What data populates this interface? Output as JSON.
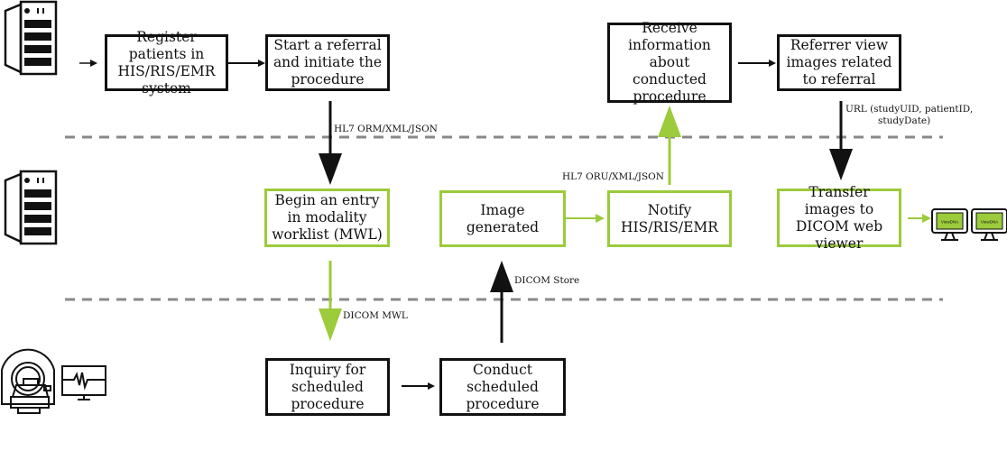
{
  "colors": {
    "primary": "#111111",
    "accent": "#9ccb3b",
    "divider": "#888888"
  },
  "icons": {
    "top": "server-icon",
    "middle": "server-icon",
    "bottom": "ct-scanner-icon",
    "bottom_monitor": "waveform-monitor-icon",
    "viewer": "viewer-monitor-icon"
  },
  "boxes": {
    "register": "Register patients in HIS/RIS/EMR system",
    "referral": "Start a referral and initiate the procedure",
    "receive": "Receive information about conducted procedure",
    "referrer_view": "Referrer view images related to referral",
    "mwl_entry": "Begin an entry in modality worklist (MWL)",
    "image_generated": "Image generated",
    "notify": "Notify HIS/RIS/EMR",
    "transfer": "Transfer images to DICOM web viewer",
    "inquiry": "Inquiry for scheduled procedure",
    "conduct": "Conduct scheduled procedure"
  },
  "labels": {
    "hl7_orm": "HL7 ORM/XML/JSON",
    "hl7_oru": "HL7 ORU/XML/JSON",
    "dicom_mwl": "DICOM MWL",
    "dicom_store": "DICOM Store",
    "url_line1": "URL (studyUID, patientID,",
    "url_line2": "studyDate)"
  },
  "viewer_screen_text": "ViewDNA"
}
